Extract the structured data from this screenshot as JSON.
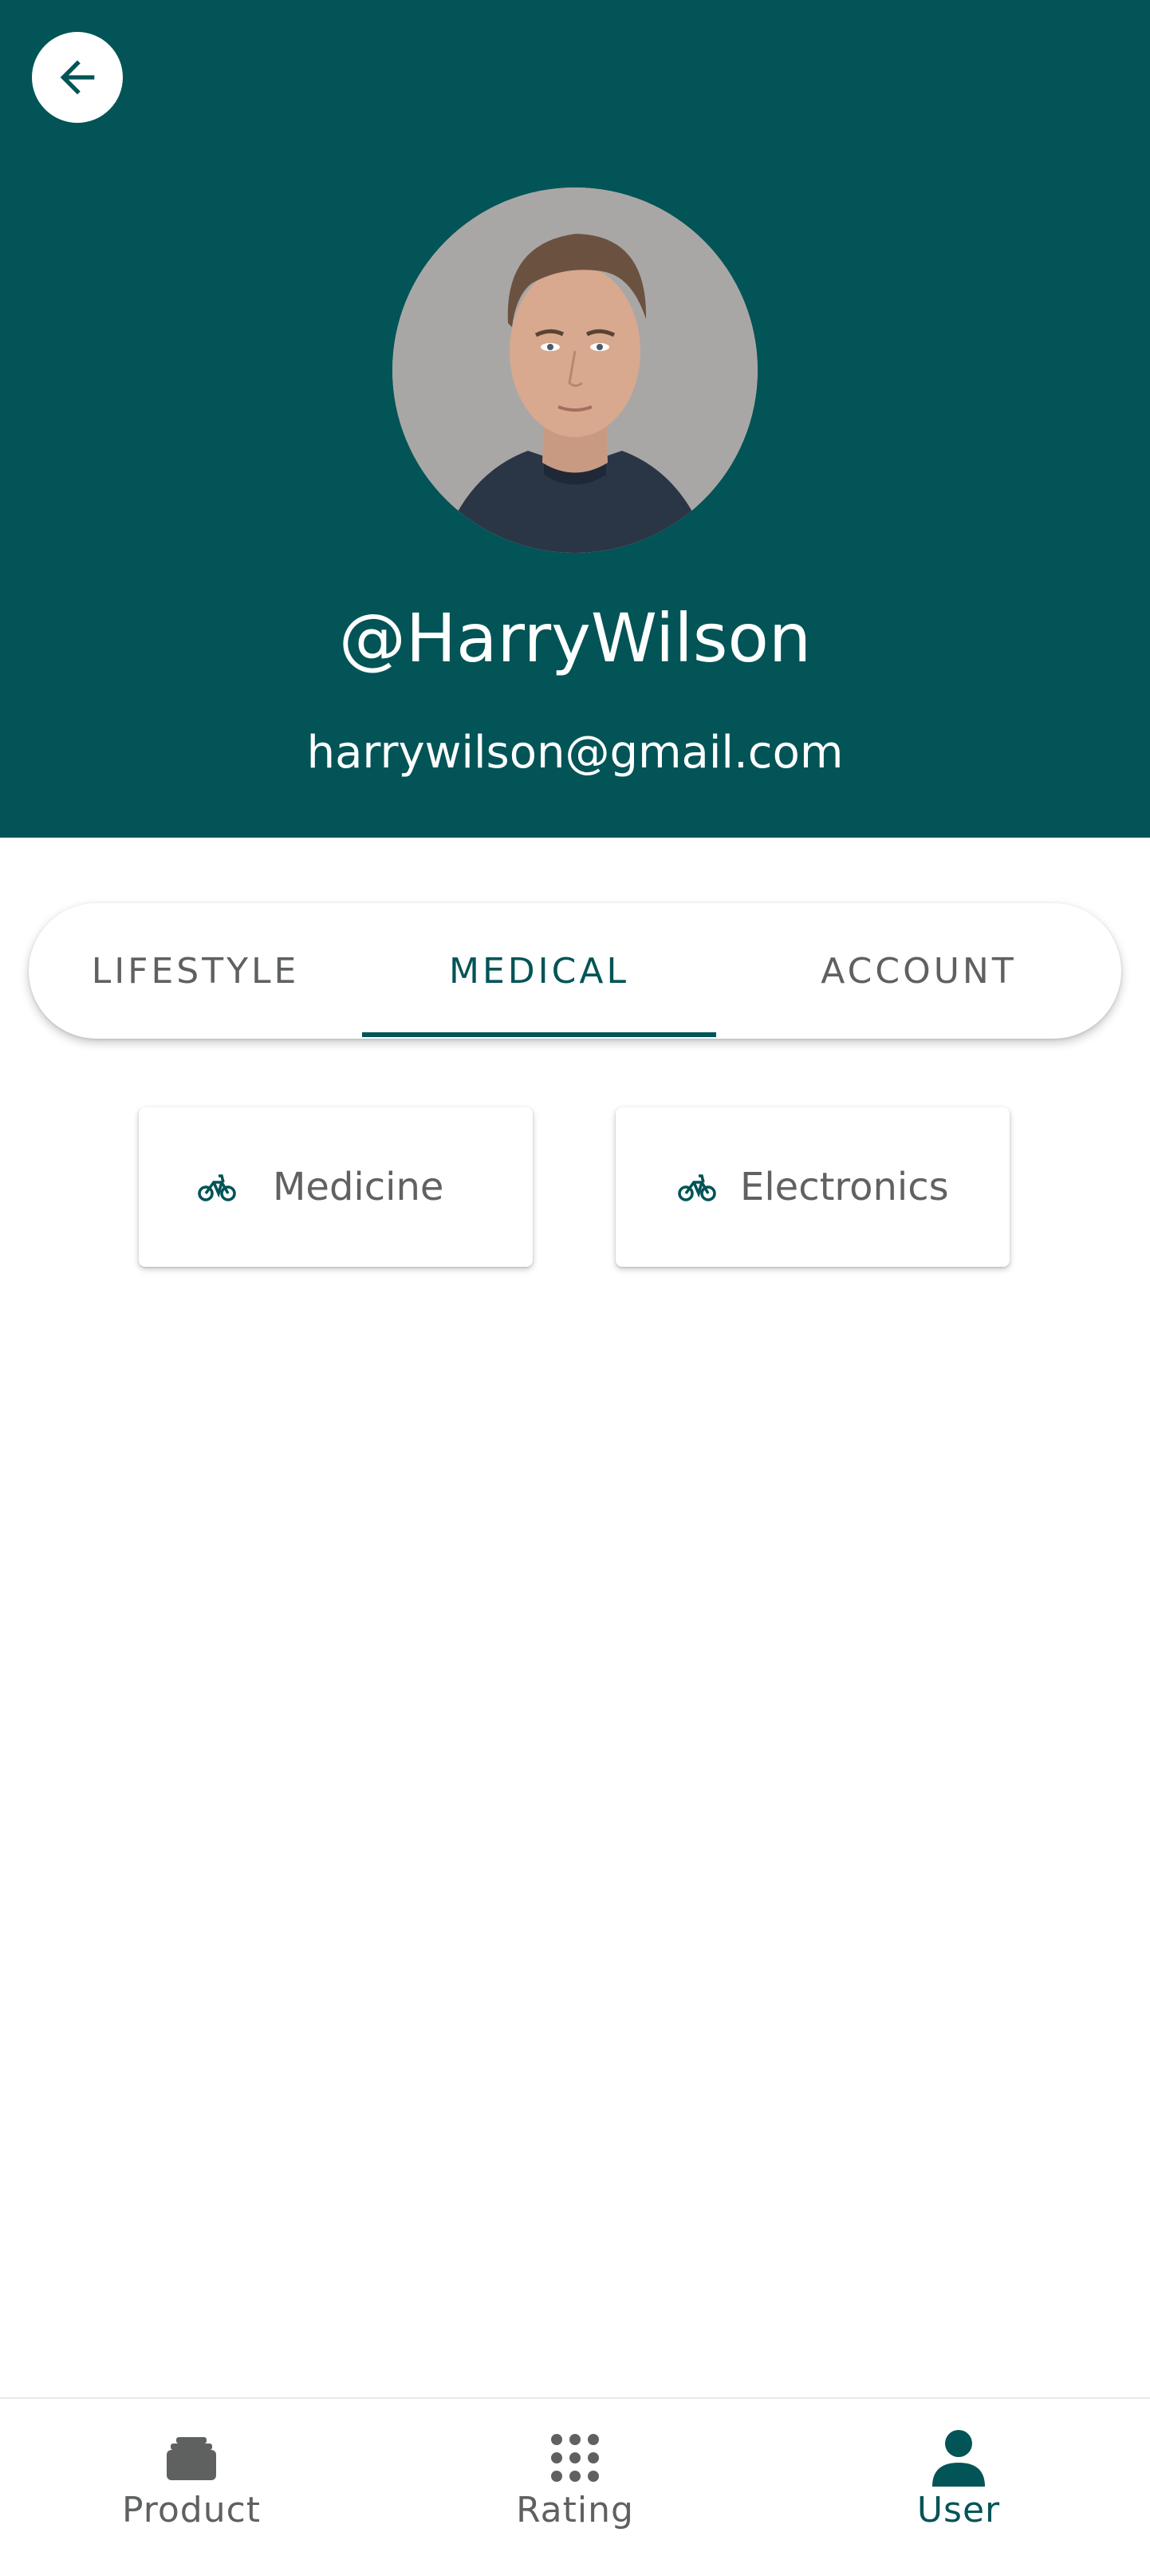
{
  "colors": {
    "primary": "#025457",
    "text_muted": "#5f6161",
    "card_text": "#616161",
    "background": "#ffffff"
  },
  "header": {
    "back_icon": "arrow-left-icon",
    "avatar": "profile-photo",
    "username": "@HarryWilson",
    "email": "harrywilson@gmail.com"
  },
  "tabs": [
    {
      "label": "LIFESTYLE",
      "active": false
    },
    {
      "label": "MEDICAL",
      "active": true
    },
    {
      "label": "ACCOUNT",
      "active": false
    }
  ],
  "categories": [
    {
      "label": "Medicine",
      "icon": "bicycle-icon"
    },
    {
      "label": "Electronics",
      "icon": "bicycle-icon"
    }
  ],
  "bottom_nav": [
    {
      "label": "Product",
      "icon": "stack-icon",
      "active": false
    },
    {
      "label": "Rating",
      "icon": "grid-dots-icon",
      "active": false
    },
    {
      "label": "User",
      "icon": "person-icon",
      "active": true
    }
  ]
}
